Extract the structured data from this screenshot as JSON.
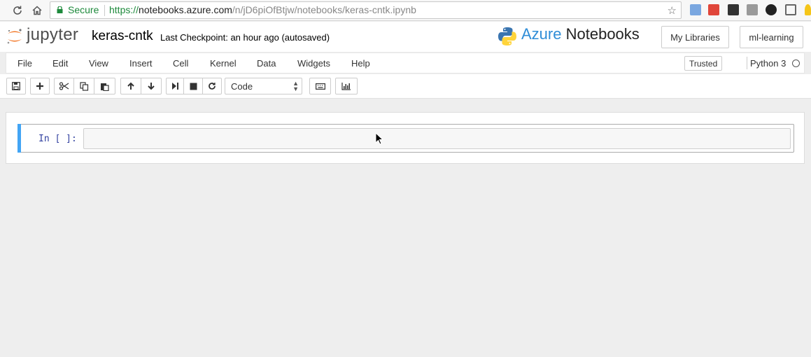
{
  "browser": {
    "secure_label": "Secure",
    "url_scheme": "https://",
    "url_domain": "notebooks.azure.com",
    "url_path": "/n/jD6piOfBtjw/notebooks/keras-cntk.ipynb"
  },
  "header": {
    "logo_text": "jupyter",
    "notebook_name": "keras-cntk",
    "checkpoint": "Last Checkpoint: an hour ago (autosaved)",
    "azure_word": "Azure",
    "notebooks_word": "Notebooks",
    "my_libraries": "My Libraries",
    "library_name": "ml-learning"
  },
  "menu": {
    "items": [
      "File",
      "Edit",
      "View",
      "Insert",
      "Cell",
      "Kernel",
      "Data",
      "Widgets",
      "Help"
    ],
    "trusted": "Trusted",
    "kernel": "Python 3"
  },
  "toolbar": {
    "cell_type": "Code"
  },
  "cell": {
    "prompt": "In [ ]:",
    "content": ""
  },
  "colors": {
    "accent": "#42a5f5",
    "azure_blue": "#2f8dd7",
    "jupyter_orange": "#f37726",
    "secure_green": "#1e8a3c"
  }
}
